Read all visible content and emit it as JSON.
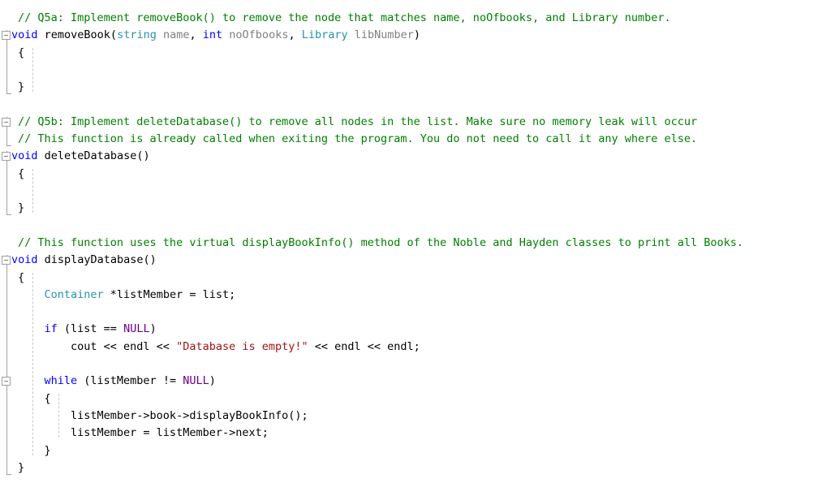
{
  "editor": {
    "language": "C++",
    "background": "#ffffff",
    "char_width": 8.0,
    "line_height": 21.3,
    "text_left": 14,
    "colors": {
      "comment": "#008000",
      "keyword": "#0000ff",
      "type": "#2b91af",
      "parameter": "#808080",
      "string": "#a31515",
      "macro": "#6f008a",
      "plain": "#000000",
      "gutter_line": "#a0a0a0",
      "indent_guide": "#c8c8c8"
    }
  },
  "lines": [
    {
      "indent": 1,
      "tokens": [
        {
          "t": "// Q5a: Implement removeBook() to remove the node that matches name, noOfbooks, and Library number.",
          "c": "cmt"
        }
      ]
    },
    {
      "indent": 0,
      "tokens": [
        {
          "t": "void",
          "c": "kw"
        },
        {
          "t": " removeBook(",
          "c": "pln"
        },
        {
          "t": "string",
          "c": "typ"
        },
        {
          "t": " ",
          "c": "pln"
        },
        {
          "t": "name",
          "c": "par"
        },
        {
          "t": ", ",
          "c": "pln"
        },
        {
          "t": "int",
          "c": "kw"
        },
        {
          "t": " ",
          "c": "pln"
        },
        {
          "t": "noOfbooks",
          "c": "par"
        },
        {
          "t": ", ",
          "c": "pln"
        },
        {
          "t": "Library",
          "c": "typ"
        },
        {
          "t": " ",
          "c": "pln"
        },
        {
          "t": "libNumber",
          "c": "par"
        },
        {
          "t": ")",
          "c": "pln"
        }
      ]
    },
    {
      "indent": 1,
      "tokens": [
        {
          "t": "{",
          "c": "pln"
        }
      ]
    },
    {
      "indent": 1,
      "tokens": [
        {
          "t": "",
          "c": "pln"
        }
      ]
    },
    {
      "indent": 1,
      "tokens": [
        {
          "t": "}",
          "c": "pln"
        }
      ]
    },
    {
      "indent": 1,
      "tokens": [
        {
          "t": "",
          "c": "pln"
        }
      ]
    },
    {
      "indent": 1,
      "tokens": [
        {
          "t": "// Q5b: Implement deleteDatabase() to remove all nodes in the list. Make sure no memory leak will occur",
          "c": "cmt"
        }
      ]
    },
    {
      "indent": 1,
      "tokens": [
        {
          "t": "// This function is already called when exiting the program. You do not need to call it any where else.",
          "c": "cmt"
        }
      ]
    },
    {
      "indent": 0,
      "tokens": [
        {
          "t": "void",
          "c": "kw"
        },
        {
          "t": " deleteDatabase()",
          "c": "pln"
        }
      ]
    },
    {
      "indent": 1,
      "tokens": [
        {
          "t": "{",
          "c": "pln"
        }
      ]
    },
    {
      "indent": 1,
      "tokens": [
        {
          "t": "",
          "c": "pln"
        }
      ]
    },
    {
      "indent": 1,
      "tokens": [
        {
          "t": "}",
          "c": "pln"
        }
      ]
    },
    {
      "indent": 1,
      "tokens": [
        {
          "t": "",
          "c": "pln"
        }
      ]
    },
    {
      "indent": 1,
      "tokens": [
        {
          "t": "// This function uses the virtual displayBookInfo() method of the Noble and Hayden classes to print all Books.",
          "c": "cmt"
        }
      ]
    },
    {
      "indent": 0,
      "tokens": [
        {
          "t": "void",
          "c": "kw"
        },
        {
          "t": " displayDatabase()",
          "c": "pln"
        }
      ]
    },
    {
      "indent": 1,
      "tokens": [
        {
          "t": "{",
          "c": "pln"
        }
      ]
    },
    {
      "indent": 1,
      "tokens": [
        {
          "t": "    ",
          "c": "pln"
        },
        {
          "t": "Container",
          "c": "typ"
        },
        {
          "t": " *listMember = list;",
          "c": "pln"
        }
      ]
    },
    {
      "indent": 1,
      "tokens": [
        {
          "t": "",
          "c": "pln"
        }
      ]
    },
    {
      "indent": 1,
      "tokens": [
        {
          "t": "    ",
          "c": "pln"
        },
        {
          "t": "if",
          "c": "kw"
        },
        {
          "t": " (list == ",
          "c": "pln"
        },
        {
          "t": "NULL",
          "c": "mac"
        },
        {
          "t": ")",
          "c": "pln"
        }
      ]
    },
    {
      "indent": 1,
      "tokens": [
        {
          "t": "        cout << endl << ",
          "c": "pln"
        },
        {
          "t": "\"Database is empty!\"",
          "c": "str"
        },
        {
          "t": " << endl << endl;",
          "c": "pln"
        }
      ]
    },
    {
      "indent": 1,
      "tokens": [
        {
          "t": "",
          "c": "pln"
        }
      ]
    },
    {
      "indent": 1,
      "tokens": [
        {
          "t": "    ",
          "c": "pln"
        },
        {
          "t": "while",
          "c": "kw"
        },
        {
          "t": " (listMember != ",
          "c": "pln"
        },
        {
          "t": "NULL",
          "c": "mac"
        },
        {
          "t": ")",
          "c": "pln"
        }
      ]
    },
    {
      "indent": 1,
      "tokens": [
        {
          "t": "    {",
          "c": "pln"
        }
      ]
    },
    {
      "indent": 1,
      "tokens": [
        {
          "t": "        listMember->book->displayBookInfo();",
          "c": "pln"
        }
      ]
    },
    {
      "indent": 1,
      "tokens": [
        {
          "t": "        listMember = listMember->next;",
          "c": "pln"
        }
      ]
    },
    {
      "indent": 1,
      "tokens": [
        {
          "t": "    }",
          "c": "pln"
        }
      ]
    },
    {
      "indent": 1,
      "tokens": [
        {
          "t": "}",
          "c": "pln"
        }
      ]
    }
  ],
  "outlining": {
    "collapse_markers": [
      {
        "name": "collapse-removebook",
        "line": 1
      },
      {
        "name": "collapse-q5b-comment",
        "line": 6
      },
      {
        "name": "collapse-deletedatabase",
        "line": 8
      },
      {
        "name": "collapse-displaydatabase",
        "line": 14
      },
      {
        "name": "collapse-while-block",
        "line": 21
      }
    ],
    "scope_bars": [
      {
        "from": 1,
        "to": 4
      },
      {
        "from": 6,
        "to": 7
      },
      {
        "from": 8,
        "to": 11
      },
      {
        "from": 14,
        "to": 26
      }
    ],
    "indent_guides": [
      {
        "from": 2,
        "to": 4
      },
      {
        "from": 9,
        "to": 11
      },
      {
        "from": 15,
        "to": 25
      },
      {
        "from": 22,
        "to": 24,
        "level": 2
      }
    ]
  }
}
